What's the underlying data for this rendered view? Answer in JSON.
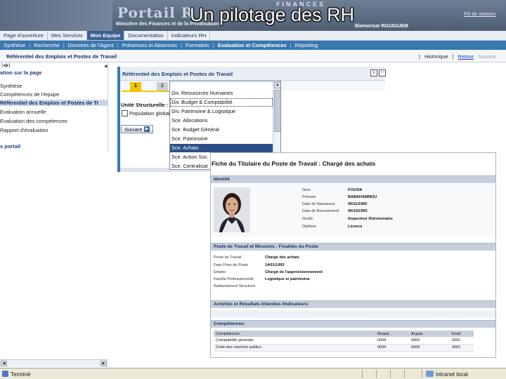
{
  "banner": {
    "logo_text": "Portail R",
    "finances_text": "FINANCES",
    "ministry_text": "Ministère des Finances et de la Privatisation",
    "slide_title": "Un pilotage des RH",
    "welcome": "Bienvenue RGUIGUEM",
    "logout": "Fin de session"
  },
  "top_nav": {
    "items": [
      "Page d'ouverture",
      "Mes Services",
      "Mon Equipe",
      "Documentation",
      "Indicateurs RH"
    ],
    "active_index": 2
  },
  "sub_nav": {
    "items": [
      "Synthèse",
      "Recherche",
      "Données de l'Agent",
      "Présences et Absences",
      "Formation",
      "Evaluation et Compétences",
      "Reporting"
    ],
    "active_index": 5
  },
  "page_header": {
    "title": "Référentiel des Emplois et Postes de Travail",
    "history": "Historique",
    "back": "Retour",
    "next": "Suivant"
  },
  "left_nav": {
    "toggles": "|◂|▸|",
    "section_title": "ation sur la page",
    "items": [
      "Synthèse",
      "Compétences de l'équipe",
      "Référentiel des Emplois et Postes de Tr",
      "Evaluation annuelle",
      "Evaluation des compétences",
      "Rapport d'évaluation"
    ],
    "active_index": 2,
    "portal_link": "s portail"
  },
  "main_panel": {
    "title": "Référentiel des Emplois et Postes de Travail",
    "steps": [
      "1",
      "2"
    ],
    "unit_label": "Unité Structurelle :",
    "checkbox_label": "Population globale",
    "next_button": "Suivant"
  },
  "dropdown": {
    "options": [
      "Div.  Ressources Humaines",
      "Div. Budget & Comptabilité",
      "Div. Patrimoine & Logistique",
      "Sce.  Allocations",
      "Sce.  Budget Général",
      "Sce.  Patrimoine",
      "Sce.  Achats",
      "Sce.  Action Soc",
      "Sce.  Centralisat"
    ],
    "focused_index": 1,
    "selected_index": 6
  },
  "fiche": {
    "title": "Fiche du Titulaire du Poste de Travail : Chargé des achats",
    "identity_header": "Identité",
    "identity": [
      {
        "label": "Nom",
        "value": "FOUZIA"
      },
      {
        "label": "Prénom",
        "value": "BABAHAMMOU"
      },
      {
        "label": "Date de Naissance",
        "value": "06/11/1960"
      },
      {
        "label": "Date de Recrutement",
        "value": "06/10/1993"
      },
      {
        "label": "Grade",
        "value": "Inspecteur Divisionnaire"
      },
      {
        "label": "Diplôme",
        "value": "Licence"
      }
    ],
    "post_header": "Poste de Travail et Missions : Finalités du Poste:",
    "post": [
      {
        "label": "Poste de Travail",
        "value": "Chargé des achats"
      },
      {
        "label": "Date Prise de Poste",
        "value": "14/01/1993"
      },
      {
        "label": "Emploi",
        "value": "Chargé de l'approvisionnement"
      },
      {
        "label": "Famille Professionnelle",
        "value": "Logistique et patrimoine"
      },
      {
        "label": "Rattachement Structurel",
        "value": ""
      }
    ],
    "activities_header": "Activités et Résultats Attendus /Indicateurs:",
    "skills_header": "Compétences:",
    "skills_columns": [
      "Compétences",
      "Requis",
      "Acquis",
      "Ecart"
    ],
    "skills_rows": [
      [
        "Comptabilité générale",
        "0004",
        "0000",
        "0001"
      ],
      [
        "Code des marchés publics",
        "0004",
        "0000",
        "0001"
      ]
    ]
  },
  "status_bar": {
    "done": "Terminé",
    "zone": "Intranet local"
  }
}
